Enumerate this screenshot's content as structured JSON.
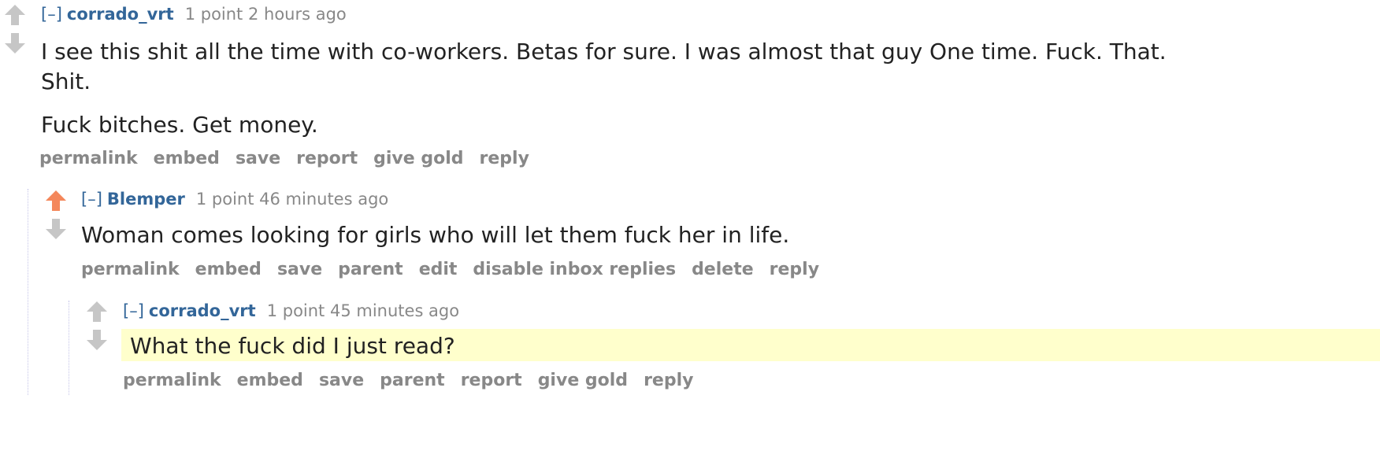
{
  "colors": {
    "author": "#336699",
    "upvoted": "#ff8b60",
    "arrow": "#c6c6c6",
    "highlight": "#ffffcc"
  },
  "comments": [
    {
      "toggle": "[–]",
      "author": "corrado_vrt",
      "score": "1 point",
      "time": "2 hours ago",
      "body": [
        "I see this shit all the time with co-workers. Betas for sure. I was almost that guy One time. Fuck. That.",
        "Shit.",
        "Fuck bitches. Get money."
      ],
      "buttons": [
        "permalink",
        "embed",
        "save",
        "report",
        "give gold",
        "reply"
      ]
    },
    {
      "toggle": "[–]",
      "author": "Blemper",
      "score": "1 point",
      "time": "46 minutes ago",
      "body": [
        "Woman comes looking for girls who will let them fuck her in life."
      ],
      "buttons": [
        "permalink",
        "embed",
        "save",
        "parent",
        "edit",
        "disable inbox replies",
        "delete",
        "reply"
      ]
    },
    {
      "toggle": "[–]",
      "author": "corrado_vrt",
      "score": "1 point",
      "time": "45 minutes ago",
      "body": [
        "What the fuck did I just read?"
      ],
      "buttons": [
        "permalink",
        "embed",
        "save",
        "parent",
        "report",
        "give gold",
        "reply"
      ]
    }
  ]
}
